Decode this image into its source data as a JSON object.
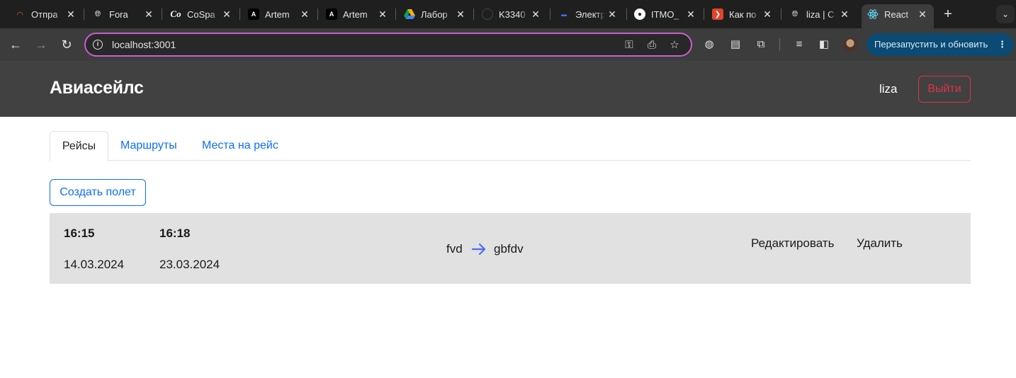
{
  "browser": {
    "tabs": [
      {
        "title": "Отпра",
        "icon": "gauge-icon",
        "color": "#e8553c"
      },
      {
        "title": "Fora",
        "icon": "globe-icon",
        "color": "#e3e3e3"
      },
      {
        "title": "CoSpa",
        "icon": "cospace-icon",
        "color": "#ffffff"
      },
      {
        "title": "Artem",
        "icon": "anthropic-icon",
        "color": "#ffffff"
      },
      {
        "title": "Artem",
        "icon": "anthropic-icon",
        "color": "#ffffff"
      },
      {
        "title": "Лабор",
        "icon": "google-drive-icon",
        "color": "#f4b400"
      },
      {
        "title": "K3340",
        "icon": "github-icon",
        "color": "#555555"
      },
      {
        "title": "Электр",
        "icon": "doc-icon",
        "color": "#4a6cf7"
      },
      {
        "title": "ITMO_",
        "icon": "github-icon",
        "color": "#ffffff"
      },
      {
        "title": "Как по",
        "icon": "youtube-icon",
        "color": "#e0452b"
      },
      {
        "title": "liza | С",
        "icon": "globe-icon",
        "color": "#e3e3e3"
      },
      {
        "title": "React",
        "icon": "react-icon",
        "color": "#61dafb",
        "active": true
      }
    ],
    "address": "localhost:3001",
    "relaunch_label": "Перезапустить и обновить"
  },
  "app": {
    "brand": "Авиасейлс",
    "username": "liza",
    "logout_label": "Выйти",
    "tabs": [
      "Рейсы",
      "Маршруты",
      "Места на рейс"
    ],
    "create_label": "Создать полет",
    "flights": [
      {
        "departure_time": "16:15",
        "departure_date": "14.03.2024",
        "arrival_time": "16:18",
        "arrival_date": "23.03.2024",
        "from": "fvd",
        "to": "gbfdv",
        "edit_label": "Редактировать",
        "delete_label": "Удалить"
      }
    ]
  },
  "colors": {
    "header_bg": "#414141",
    "card_bg": "#e1e1e1",
    "primary": "#0d6efd",
    "danger": "#dc3545",
    "arrow": "#4a6cf7"
  }
}
